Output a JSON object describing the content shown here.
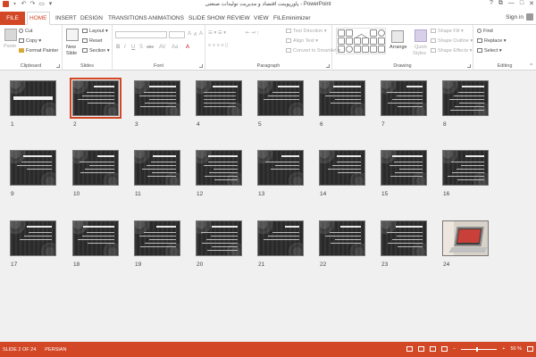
{
  "window": {
    "title": "پاورپوینت اقتصاد و مدیریت تولیدات صنعتی - PowerPoint",
    "help": "?",
    "minimize": "—",
    "maximize": "□",
    "close": "✕"
  },
  "tabs": {
    "file": "FILE",
    "items": [
      "HOME",
      "INSERT",
      "DESIGN",
      "TRANSITIONS",
      "ANIMATIONS",
      "SLIDE SHOW",
      "REVIEW",
      "VIEW",
      "FILEminimizer"
    ],
    "active": "HOME",
    "sign_in": "Sign in"
  },
  "ribbon": {
    "clipboard": {
      "label": "Clipboard",
      "paste": "Paste",
      "cut": "Cut",
      "copy": "Copy",
      "format_painter": "Format Painter"
    },
    "slides": {
      "label": "Slides",
      "new_slide_1": "New",
      "new_slide_2": "Slide",
      "layout": "Layout",
      "reset": "Reset",
      "section": "Section"
    },
    "font": {
      "label": "Font",
      "bold": "B",
      "italic": "I",
      "underline": "U",
      "strike": "S",
      "abc": "abc",
      "aa": "Aa",
      "grow": "A",
      "shrink": "A",
      "clear": "A"
    },
    "paragraph": {
      "label": "Paragraph",
      "text_direction": "Text Direction",
      "align_text": "Align Text",
      "convert": "Convert to SmartArt"
    },
    "drawing": {
      "label": "Drawing",
      "arrange": "Arrange",
      "quick_styles_1": "Quick",
      "quick_styles_2": "Styles",
      "shape_fill": "Shape Fill",
      "shape_outline": "Shape Outline",
      "shape_effects": "Shape Effects"
    },
    "editing": {
      "label": "Editing",
      "find": "Find",
      "replace": "Replace",
      "select": "Select"
    }
  },
  "slides": [
    {
      "n": "1",
      "kind": "title"
    },
    {
      "n": "2",
      "kind": "text",
      "selected": true
    },
    {
      "n": "3",
      "kind": "text"
    },
    {
      "n": "4",
      "kind": "table"
    },
    {
      "n": "5",
      "kind": "text"
    },
    {
      "n": "6",
      "kind": "text"
    },
    {
      "n": "7",
      "kind": "text"
    },
    {
      "n": "8",
      "kind": "text"
    },
    {
      "n": "9",
      "kind": "text"
    },
    {
      "n": "10",
      "kind": "text"
    },
    {
      "n": "11",
      "kind": "text"
    },
    {
      "n": "12",
      "kind": "text"
    },
    {
      "n": "13",
      "kind": "text"
    },
    {
      "n": "14",
      "kind": "text"
    },
    {
      "n": "15",
      "kind": "text"
    },
    {
      "n": "16",
      "kind": "text"
    },
    {
      "n": "17",
      "kind": "text"
    },
    {
      "n": "18",
      "kind": "text"
    },
    {
      "n": "19",
      "kind": "text"
    },
    {
      "n": "20",
      "kind": "text"
    },
    {
      "n": "21",
      "kind": "text"
    },
    {
      "n": "22",
      "kind": "text"
    },
    {
      "n": "23",
      "kind": "text"
    },
    {
      "n": "24",
      "kind": "photo"
    }
  ],
  "status": {
    "slide_info": "SLIDE 2 OF 24",
    "language": "PERSIAN",
    "zoom": "50 %"
  },
  "colors": {
    "accent": "#d24726"
  }
}
